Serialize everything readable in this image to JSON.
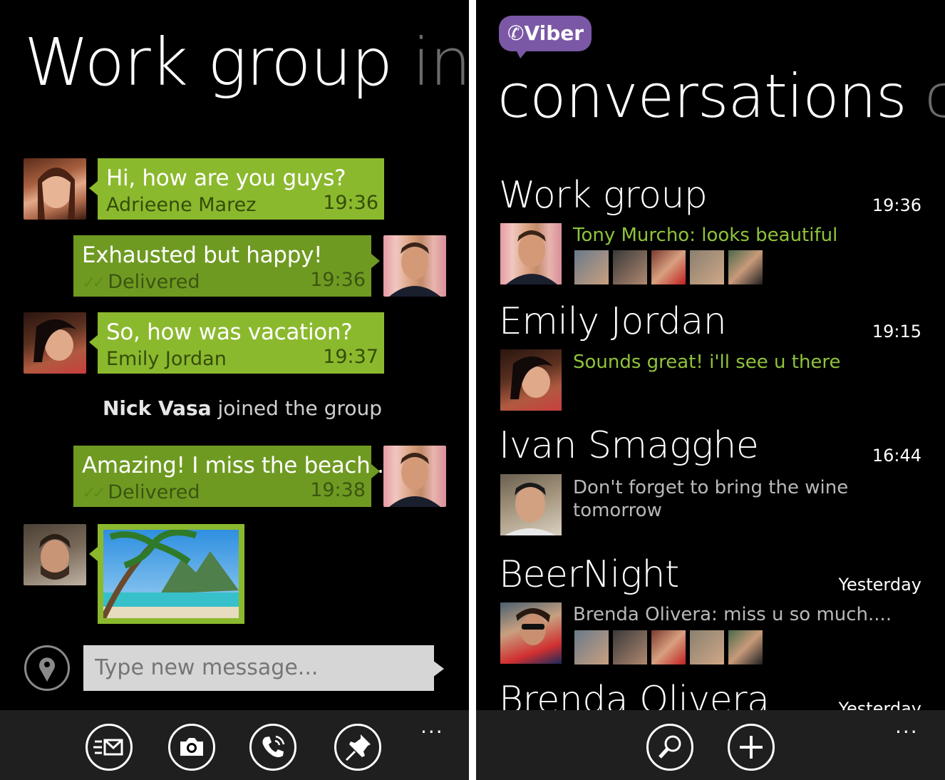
{
  "chat": {
    "title": "Work group",
    "title_next": "info",
    "messages": [
      {
        "text": "Hi, how are you guys?",
        "sender": "Adrieene Marez",
        "time": "19:36",
        "direction": "incoming"
      },
      {
        "text": "Exhausted but happy!",
        "status": "Delivered",
        "time": "19:36",
        "direction": "outgoing"
      },
      {
        "text": "So, how was vacation?",
        "sender": "Emily Jordan",
        "time": "19:37",
        "direction": "incoming"
      },
      {
        "text": "Amazing! I miss the beach...",
        "status": "Delivered",
        "time": "19:38",
        "direction": "outgoing"
      }
    ],
    "system": {
      "name": "Nick Vasa",
      "action": "joined the group"
    },
    "compose": {
      "placeholder": "Type new message..."
    },
    "appbar": [
      "compose-sms-icon",
      "camera-icon",
      "call-icon",
      "pin-icon"
    ],
    "more": "..."
  },
  "conversations": {
    "logo": "Viber",
    "title": "conversations",
    "title_next": "co",
    "items": [
      {
        "name": "Work group",
        "time": "19:36",
        "message": "Tony Murcho: looks beautiful",
        "unread": true
      },
      {
        "name": "Emily Jordan",
        "time": "19:15",
        "message": "Sounds great! i'll see u there",
        "unread": true
      },
      {
        "name": "Ivan Smagghe",
        "time": "16:44",
        "message": "Don't forget to bring the wine",
        "message_2": "tomorrow",
        "unread": false
      },
      {
        "name": "BeerNight",
        "time": "Yesterday",
        "message": "Brenda Olivera: miss u so much....",
        "unread": false
      },
      {
        "name": "Brenda Olivera",
        "time": "Yesterday"
      }
    ],
    "appbar": [
      "search-icon",
      "add-icon"
    ],
    "more": "..."
  },
  "colors": {
    "accent_green": "#8bb92e",
    "outgoing_green": "#6f9a22",
    "viber_purple": "#7b58a6",
    "background": "#000000",
    "appbar": "#1f1f1f"
  }
}
